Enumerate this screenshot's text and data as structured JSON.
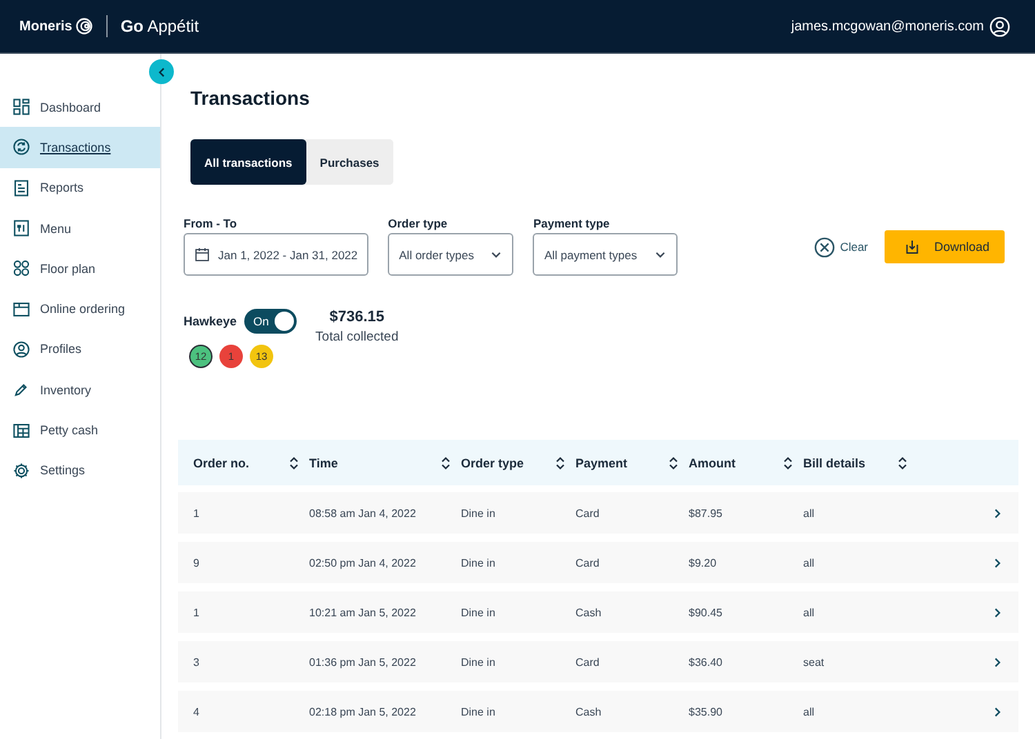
{
  "header": {
    "brand": "Moneris",
    "product_bold": "Go",
    "product": "Appétit",
    "user_email": "james.mcgowan@moneris.com"
  },
  "sidebar": {
    "items": [
      {
        "label": "Dashboard",
        "selected": false
      },
      {
        "label": "Transactions",
        "selected": true
      },
      {
        "label": "Reports",
        "selected": false
      },
      {
        "label": "Menu",
        "selected": false
      },
      {
        "label": "Floor plan",
        "selected": false
      },
      {
        "label": "Online ordering",
        "selected": false
      },
      {
        "label": "Profiles",
        "selected": false
      },
      {
        "label": "Inventory",
        "selected": false
      },
      {
        "label": "Petty cash",
        "selected": false
      },
      {
        "label": "Settings",
        "selected": false
      }
    ]
  },
  "page_title": "Transactions",
  "tabs": [
    {
      "label": "All transactions",
      "selected": true
    },
    {
      "label": "Purchases",
      "selected": false
    }
  ],
  "filters": [
    {
      "kind": "date",
      "label": "From - To",
      "value": "Jan 1, 2022 - Jan 31, 2022"
    },
    {
      "kind": "select",
      "label": "Order type",
      "value": "All order types"
    },
    {
      "kind": "select",
      "label": "Payment type",
      "value": "All payment types"
    }
  ],
  "clear_button": "Clear",
  "download_button": "Download",
  "hawkeye": {
    "label": "Hawkeye",
    "toggle_text": "On",
    "on": true
  },
  "summary": {
    "amount": "$736.15",
    "caption": "Total collected"
  },
  "status_counts": [
    {
      "count": "12",
      "color": "#4cc17f",
      "selected": true
    },
    {
      "count": "1",
      "color": "#e8423b",
      "selected": false
    },
    {
      "count": "13",
      "color": "#f2c40f",
      "selected": false
    }
  ],
  "table": {
    "columns": [
      "Order no.",
      "Time",
      "Order type",
      "Payment",
      "Amount",
      "Bill details"
    ],
    "rows": [
      [
        "1",
        "08:58 am Jan 4, 2022",
        "Dine in",
        "Card",
        "$87.95",
        "all"
      ],
      [
        "9",
        "02:50 pm Jan 4, 2022",
        "Dine in",
        "Card",
        "$9.20",
        "all"
      ],
      [
        "1",
        "10:21 am Jan 5, 2022",
        "Dine in",
        "Cash",
        "$90.45",
        "all"
      ],
      [
        "3",
        "01:36 pm Jan 5, 2022",
        "Dine in",
        "Card",
        "$36.40",
        "seat"
      ],
      [
        "4",
        "02:18 pm Jan 5, 2022",
        "Dine in",
        "Cash",
        "$35.90",
        "all"
      ]
    ]
  }
}
